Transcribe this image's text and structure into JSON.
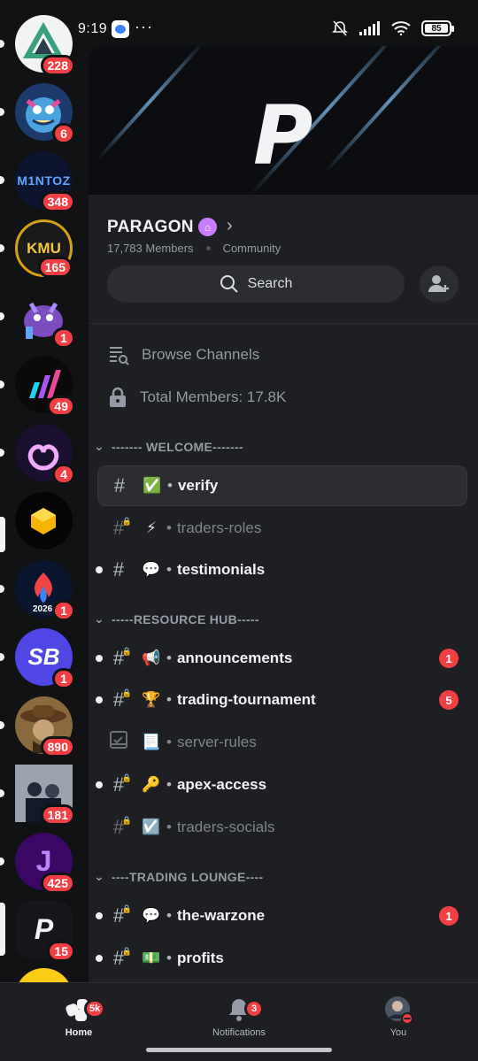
{
  "status_bar": {
    "time": "9:19",
    "battery": "85",
    "more": "···"
  },
  "server_rail": {
    "servers": [
      {
        "key": "s1",
        "badge": "228",
        "label": ""
      },
      {
        "key": "s2",
        "badge": "6",
        "label": ""
      },
      {
        "key": "s3",
        "badge": "348",
        "label": "M1NTOZ"
      },
      {
        "key": "s4",
        "badge": "165",
        "label": "KMU"
      },
      {
        "key": "s5",
        "badge": "1",
        "label": ""
      },
      {
        "key": "s6",
        "badge": "49",
        "label": ""
      },
      {
        "key": "s7",
        "badge": "4",
        "label": ""
      },
      {
        "key": "s8",
        "badge": "",
        "label": ""
      },
      {
        "key": "s9",
        "badge": "1",
        "label": "2026"
      },
      {
        "key": "s10",
        "badge": "1",
        "label": "SB"
      },
      {
        "key": "s11",
        "badge": "890",
        "label": ""
      },
      {
        "key": "s12",
        "badge": "181",
        "label": ""
      },
      {
        "key": "s13",
        "badge": "425",
        "label": "J"
      },
      {
        "key": "s14",
        "badge": "15",
        "label": "P"
      }
    ]
  },
  "guild": {
    "name": "PARAGON",
    "members": "17,783 Members",
    "type": "Community",
    "banner_logo": "P",
    "search_label": "Search"
  },
  "utilities": {
    "browse": "Browse Channels",
    "total_members": "Total Members: 17.8K"
  },
  "categories": {
    "welcome": "------- WELCOME-------",
    "resource": "-----RESOURCE HUB-----",
    "trading": "----TRADING LOUNGE----"
  },
  "channels": {
    "verify": {
      "emoji": "✅",
      "name": "verify"
    },
    "traders_roles": {
      "emoji": "⚡",
      "name": "traders-roles"
    },
    "testimonials": {
      "emoji": "💬",
      "name": "testimonials"
    },
    "announcements": {
      "emoji": "📢",
      "name": "announcements",
      "count": "1"
    },
    "trading_tournament": {
      "emoji": "🏆",
      "name": "trading-tournament",
      "count": "5"
    },
    "server_rules": {
      "emoji": "📃",
      "name": "server-rules"
    },
    "apex_access": {
      "emoji": "🔑",
      "name": "apex-access"
    },
    "traders_socials": {
      "emoji": "☑️",
      "name": "traders-socials"
    },
    "the_warzone": {
      "emoji": "💬",
      "name": "the-warzone",
      "count": "1"
    },
    "profits": {
      "emoji": "💵",
      "name": "profits"
    }
  },
  "channel_separator": "•",
  "bottom_nav": {
    "home": {
      "label": "Home",
      "badge": "5k"
    },
    "notifications": {
      "label": "Notifications",
      "badge": "3"
    },
    "you": {
      "label": "You"
    }
  },
  "colors": {
    "accent_red": "#f23f43",
    "background": "#1e1f22",
    "rail": "#111214",
    "guild_icon": "#c77dff"
  }
}
